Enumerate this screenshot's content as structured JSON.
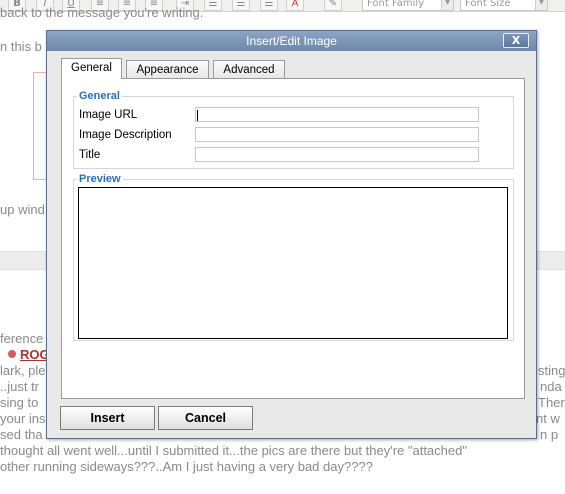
{
  "toolbar": {
    "bold": "B",
    "italic": "I",
    "underline": "U",
    "font_family": "Font Family",
    "font_size": "Font Size"
  },
  "background": {
    "line1": "back to the message you're writing.",
    "line2": "n this b",
    "line3": "up wind",
    "line4": "ference",
    "link": "ROG",
    "line5": "lark, ple",
    "line5_right": "sting",
    "line6": "..just tr",
    "line6_right": "nda",
    "line7": "sing to",
    "line7_right": "Ther",
    "line8": "your ins",
    "line8_right": "nt w",
    "line9": "sed tha",
    "line9_right": "n p",
    "line10": "thought all went well...until I submitted it...the pics are there but they're \"attached\"",
    "line11": "other running sideways???..Am I just having a very bad day????"
  },
  "dialog": {
    "title": "Insert/Edit Image",
    "close": "X",
    "tabs": [
      "General",
      "Appearance",
      "Advanced"
    ],
    "general_legend": "General",
    "fields": {
      "image_url": {
        "label": "Image URL",
        "value": ""
      },
      "image_description": {
        "label": "Image Description",
        "value": ""
      },
      "title": {
        "label": "Title",
        "value": ""
      }
    },
    "preview_legend": "Preview",
    "insert_label": "Insert",
    "cancel_label": "Cancel"
  }
}
